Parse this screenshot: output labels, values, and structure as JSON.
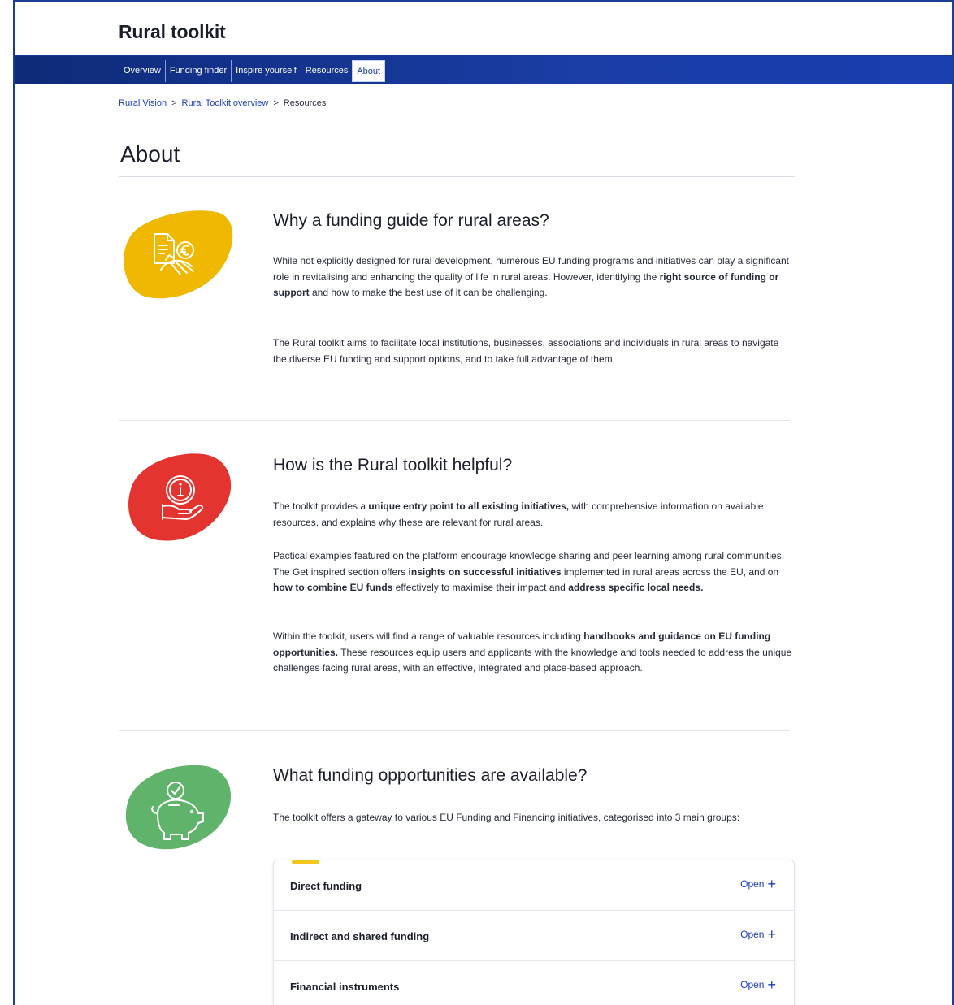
{
  "header": {
    "site_title": "Rural toolkit"
  },
  "nav": {
    "items": [
      {
        "label": "Overview"
      },
      {
        "label": "Funding finder"
      },
      {
        "label": "Inspire yourself"
      },
      {
        "label": "Resources"
      },
      {
        "label": "About"
      }
    ],
    "active": "About"
  },
  "breadcrumb": {
    "items": [
      "Rural Vision",
      "Rural Toolkit overview",
      "Resources"
    ],
    "separator": ">"
  },
  "page": {
    "title": "About"
  },
  "sections": [
    {
      "heading": "Why a funding guide for rural areas?",
      "icon": "document-euro-field-icon",
      "color": "#f0b800",
      "paragraphs": [
        [
          {
            "t": "While not explicitly designed for rural development, numerous EU funding programs and initiatives can play a significant role in revitalising and enhancing the quality of life in rural areas. However, identifying the "
          },
          {
            "t": "right source of funding or support",
            "b": true
          },
          {
            "t": " and how to make the best use of it can be challenging."
          }
        ],
        [
          {
            "t": "The Rural toolkit aims to facilitate local institutions, businesses, associations and individuals in rural areas to navigate the diverse EU funding and support options, and to take full advantage of them."
          }
        ]
      ]
    },
    {
      "heading": "How is the Rural toolkit helpful?",
      "icon": "hand-info-coin-icon",
      "color": "#e3342f",
      "paragraphs": [
        [
          {
            "t": "The toolkit provides a "
          },
          {
            "t": "unique entry point to all existing initiatives,",
            "b": true
          },
          {
            "t": " with comprehensive information on available resources, and explains why these are relevant for rural areas."
          }
        ],
        [
          {
            "t": "Pactical examples featured on the platform encourage knowledge sharing and peer learning among rural communities. The Get inspired section offers "
          },
          {
            "t": "insights on successful initiatives",
            "b": true
          },
          {
            "t": " implemented in rural areas across the EU, and  on "
          },
          {
            "t": "how to combine EU funds",
            "b": true
          },
          {
            "t": " effectively to maximise their impact and "
          },
          {
            "t": "address specific local needs.",
            "b": true
          }
        ],
        [
          {
            "t": "Within the toolkit, users will find a range of valuable resources including "
          },
          {
            "t": "handbooks and guidance on EU funding opportunities.",
            "b": true
          },
          {
            "t": " These resources equip users and applicants with the knowledge and tools needed to address the unique challenges facing rural areas, with an effective, integrated and place-based approach."
          }
        ]
      ]
    },
    {
      "heading": "What funding opportunities are available?",
      "icon": "piggy-bank-check-icon",
      "color": "#5fb36a",
      "paragraphs": [
        [
          {
            "t": "The toolkit offers a gateway to various EU Funding and Financing initiatives, categorised into 3 main groups:"
          }
        ]
      ]
    }
  ],
  "accordion": {
    "toggle_label": "Open",
    "accent_color": "#f0c81c",
    "items": [
      {
        "label": "Direct funding"
      },
      {
        "label": "Indirect and shared funding"
      },
      {
        "label": "Financial instruments"
      }
    ]
  },
  "colors": {
    "brand_blue": "#1a3da6",
    "link": "#1d3db8"
  }
}
